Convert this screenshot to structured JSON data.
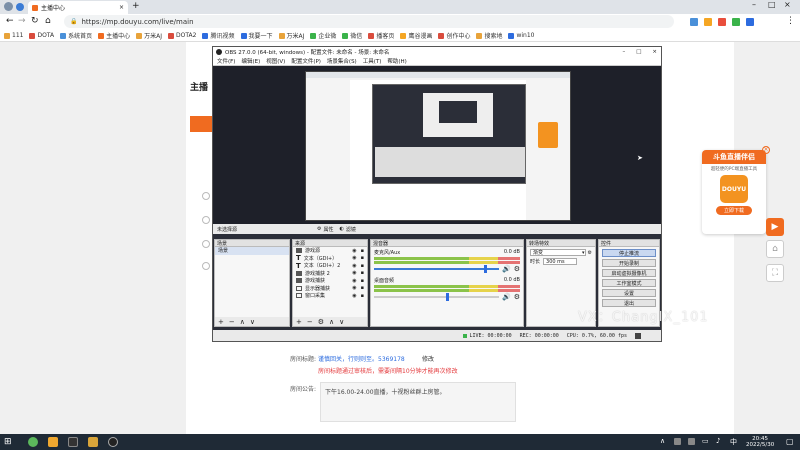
{
  "browser": {
    "tab_title": "主播中心",
    "url": "https://mp.douyu.com/live/main",
    "bookmarks": [
      "111",
      "DOTA",
      "系统首页",
      "主播中心",
      "万米AJ",
      "DOTA2",
      "腾讯视频",
      "我要一下",
      "万米AJ",
      "企业微",
      "微信",
      "播客页",
      "鹰谷漫画",
      "创作中心",
      "搜索地",
      "win10"
    ]
  },
  "page": {
    "side_title": "主播",
    "field_room_title_label": "房间标题:",
    "field_room_title_value": "谨慎回关，行则则至。5369178",
    "field_room_title_action": "修改",
    "notice_text": "房间标题通过审核后，需要间隔10分钟才能再次修改",
    "field_announce_label": "房间公告:",
    "field_announce_value": "下午16.00-24.00直播，十视粉丝群上房管。"
  },
  "ad": {
    "title": "斗鱼直播伴侣",
    "subtitle": "超轻便的PC端直播工具",
    "logo_text": "DOUYU",
    "button": "立即下载"
  },
  "watermark": "VX：ChangIX_101",
  "obs": {
    "title": "OBS 27.0.0 (64-bit, windows) - 配置文件: 未命名 - 场景: 未命名",
    "menu": [
      "文件(F)",
      "编辑(E)",
      "视图(V)",
      "配置文件(P)",
      "场景集合(S)",
      "工具(T)",
      "帮助(H)"
    ],
    "source_bar_label": "未选择源",
    "source_bar_props": "属性",
    "source_bar_filters": "滤镜",
    "scenes_header": "场景",
    "scenes": [
      "场景"
    ],
    "sources_header": "来源",
    "sources": [
      {
        "type": "eye",
        "name": "游戏源"
      },
      {
        "type": "text",
        "name": "文本（GDI+）"
      },
      {
        "type": "text",
        "name": "文本（GDI+）2"
      },
      {
        "type": "eye",
        "name": "游戏捕获 2"
      },
      {
        "type": "eye",
        "name": "游戏捕获"
      },
      {
        "type": "display",
        "name": "显示器捕获"
      },
      {
        "type": "window",
        "name": "窗口采集"
      }
    ],
    "mixer_header": "混音器",
    "mixer": [
      {
        "name": "麦克风/Aux",
        "db": "0.0 dB"
      },
      {
        "name": "桌面音频",
        "db": "0.0 dB"
      }
    ],
    "transitions_header": "转场特效",
    "transition_value": "渐变",
    "duration_label": "时长",
    "duration_value": "300 ms",
    "controls_header": "控件",
    "controls": [
      "停止推流",
      "开始录制",
      "启动虚拟摄像机",
      "工作室模式",
      "设置",
      "退出"
    ],
    "status": [
      "LIVE: 00:00:00",
      "REC: 00:00:00",
      "CPU: 0.7%, 60.00 fps"
    ]
  },
  "taskbar": {
    "time": "20:45",
    "date": "2022/5/30"
  },
  "colors": {
    "accent": "#f06b20",
    "obs_bg": "#2b2e38",
    "taskbar": "#1f2a36"
  }
}
